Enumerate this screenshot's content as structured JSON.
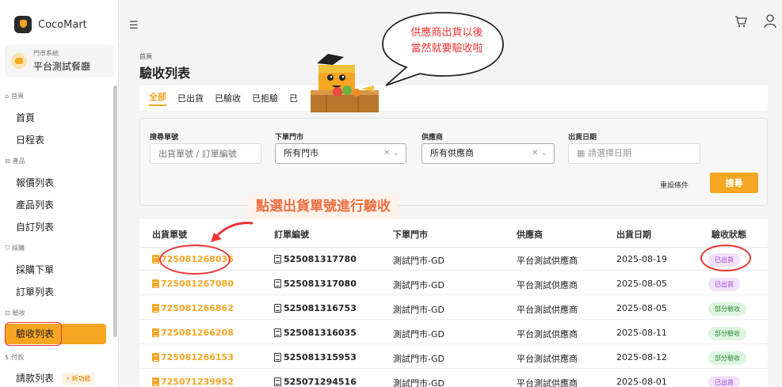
{
  "app": {
    "name": "CocoMart"
  },
  "store": {
    "system_label": "門市系統",
    "name": "平台測試餐廳"
  },
  "sidebar": {
    "groups": [
      {
        "label": "首頁",
        "items": [
          "首頁",
          "日程表"
        ]
      },
      {
        "label": "產品",
        "items": [
          "報價列表",
          "產品列表",
          "自訂列表"
        ]
      },
      {
        "label": "採購",
        "items": [
          "採購下單",
          "訂單列表"
        ]
      },
      {
        "label": "驗收",
        "items": [
          "驗收列表"
        ]
      },
      {
        "label": "付款",
        "items": [
          "請款列表"
        ]
      }
    ],
    "active_item": "驗收列表",
    "new_badge": "新功能"
  },
  "header": {
    "breadcrumb": "首頁",
    "title": "驗收列表"
  },
  "tabs": [
    "全部",
    "已出貨",
    "已驗收",
    "已拒驗",
    "已"
  ],
  "active_tab": "全部",
  "filters": {
    "shipment_no": {
      "label": "搜尋單號",
      "placeholder": "出貨單號 / 訂單編號"
    },
    "store": {
      "label": "下單門市",
      "value": "所有門市"
    },
    "supplier": {
      "label": "供應商",
      "value": "所有供應商"
    },
    "ship_date": {
      "label": "出貨日期",
      "placeholder": "請選擇日期"
    },
    "reset_label": "重設條件",
    "search_label": "搜尋"
  },
  "table": {
    "columns": [
      "出貨單號",
      "訂單編號",
      "下單門市",
      "供應商",
      "出貨日期",
      "驗收狀態"
    ],
    "rows": [
      {
        "shipment": "725081268035",
        "order": "525081317780",
        "store": "測試門市-GD",
        "supplier": "平台測試供應商",
        "date": "2025-08-19",
        "status": "已出貨",
        "status_type": "shipped"
      },
      {
        "shipment": "725081267080",
        "order": "525081317080",
        "store": "測試門市-GD",
        "supplier": "平台測試供應商",
        "date": "2025-08-05",
        "status": "已出貨",
        "status_type": "shipped"
      },
      {
        "shipment": "725081266862",
        "order": "525081316753",
        "store": "測試門市-GD",
        "supplier": "平台測試供應商",
        "date": "2025-08-05",
        "status": "部分驗收",
        "status_type": "partial"
      },
      {
        "shipment": "725081266208",
        "order": "525081316035",
        "store": "測試門市-GD",
        "supplier": "平台測試供應商",
        "date": "2025-08-11",
        "status": "部分驗收",
        "status_type": "partial"
      },
      {
        "shipment": "725081266153",
        "order": "525081315953",
        "store": "測試門市-GD",
        "supplier": "平台測試供應商",
        "date": "2025-08-12",
        "status": "部分驗收",
        "status_type": "partial"
      },
      {
        "shipment": "725071239952",
        "order": "525071294516",
        "store": "測試門市-GD",
        "supplier": "平台測試供應商",
        "date": "2025-08-01",
        "status": "已出貨",
        "status_type": "shipped"
      }
    ]
  },
  "annotations": {
    "bubble_line1": "供應商出貨以後",
    "bubble_line2": "當然就要驗收啦",
    "callout": "點選出貨單號進行驗收"
  },
  "colors": {
    "accent": "#f5a623",
    "annotation_red": "#e33333",
    "shipped": "#9b3fd1",
    "partial": "#2e8b38"
  }
}
